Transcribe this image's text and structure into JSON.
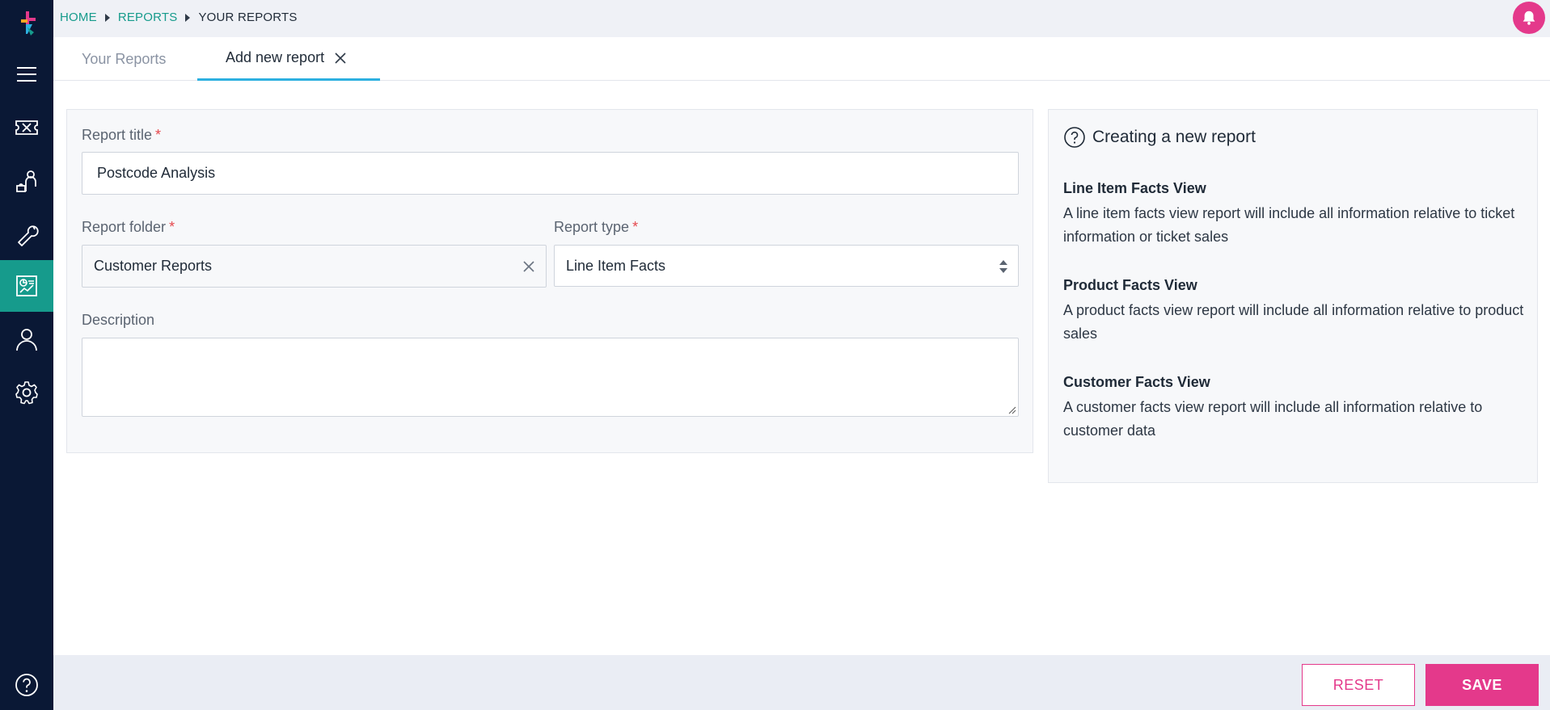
{
  "breadcrumb": {
    "home": "HOME",
    "reports": "REPORTS",
    "current": "YOUR REPORTS"
  },
  "tabs": [
    {
      "label": "Your Reports",
      "active": false
    },
    {
      "label": "Add new report",
      "active": true
    }
  ],
  "form": {
    "title_label": "Report title",
    "title_value": "Postcode Analysis",
    "folder_label": "Report folder",
    "folder_value": "Customer Reports",
    "type_label": "Report type",
    "type_value": "Line Item Facts",
    "description_label": "Description",
    "description_value": "",
    "required_mark": "*"
  },
  "info": {
    "heading": "Creating a new report",
    "sections": [
      {
        "title": "Line Item Facts View",
        "text": "A line item facts view report will include all information relative to ticket information or ticket sales"
      },
      {
        "title": "Product Facts View",
        "text": "A product facts view report will include all information relative to product sales"
      },
      {
        "title": "Customer Facts View",
        "text": "A customer facts view report will include all information relative to customer data"
      }
    ]
  },
  "footer": {
    "reset_label": "RESET",
    "save_label": "SAVE"
  },
  "colors": {
    "sidebar": "#0a1835",
    "accent_teal": "#169b8c",
    "accent_pink": "#e4398b",
    "tab_underline": "#2db0e0"
  },
  "sidebar_icons": [
    "logo-icon",
    "menu-icon",
    "ticket-icon",
    "customers-icon",
    "tools-icon",
    "reports-icon",
    "user-icon",
    "settings-icon",
    "help-icon"
  ]
}
